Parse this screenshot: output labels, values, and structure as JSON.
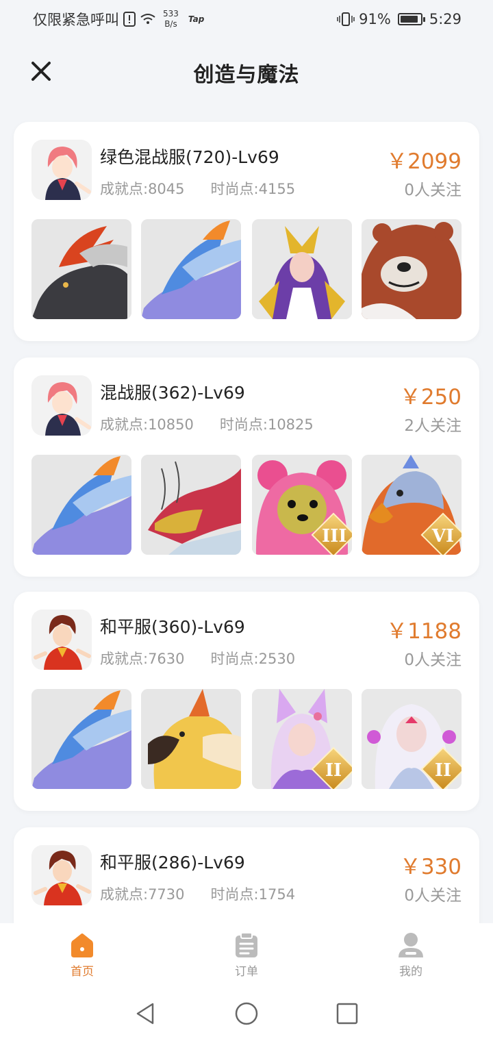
{
  "status_bar": {
    "carrier_text": "仅限紧急呼叫",
    "net_speed_value": "533",
    "net_speed_unit": "B/s",
    "tap_label": "Tap",
    "battery_percent": "91%",
    "battery_level": 0.91,
    "time": "5:29"
  },
  "header": {
    "title": "创造与魔法",
    "close_icon": "close-icon"
  },
  "listings": [
    {
      "title": "绿色混战服(720)-Lv69",
      "achievement": "成就点:8045",
      "fashion": "时尚点:4155",
      "price": "￥2099",
      "followers": "0人关注",
      "thumbs": [
        {
          "name": "black-dragon-mount",
          "rank": ""
        },
        {
          "name": "blue-dragon-mount",
          "rank": ""
        },
        {
          "name": "golden-sorceress-skin",
          "rank": ""
        },
        {
          "name": "brown-bear-mount",
          "rank": ""
        }
      ]
    },
    {
      "title": "混战服(362)-Lv69",
      "achievement": "成就点:10850",
      "fashion": "时尚点:10825",
      "price": "￥250",
      "followers": "2人关注",
      "thumbs": [
        {
          "name": "blue-dragon-mount",
          "rank": ""
        },
        {
          "name": "golden-dragon-mount",
          "rank": ""
        },
        {
          "name": "pink-bear-mount",
          "rank": "III"
        },
        {
          "name": "eagle-mount",
          "rank": "VI"
        }
      ]
    },
    {
      "title": "和平服(360)-Lv69",
      "achievement": "成就点:7630",
      "fashion": "时尚点:2530",
      "price": "￥1188",
      "followers": "0人关注",
      "thumbs": [
        {
          "name": "blue-dragon-mount",
          "rank": ""
        },
        {
          "name": "golden-eagle-mount",
          "rank": ""
        },
        {
          "name": "fox-spirit-skin",
          "rank": "II"
        },
        {
          "name": "white-spirit-skin",
          "rank": "II"
        }
      ]
    },
    {
      "title": "和平服(286)-Lv69",
      "achievement": "成就点:7730",
      "fashion": "时尚点:1754",
      "price": "￥330",
      "followers": "0人关注",
      "thumbs": []
    }
  ],
  "tabbar": {
    "tabs": [
      {
        "label": "首页",
        "icon": "home-icon",
        "active": true
      },
      {
        "label": "订单",
        "icon": "order-icon",
        "active": false
      },
      {
        "label": "我的",
        "icon": "profile-icon",
        "active": false
      }
    ]
  },
  "nav": {
    "back_icon": "back-triangle-icon",
    "home_icon": "home-circle-icon",
    "recent_icon": "recent-square-icon"
  },
  "colors": {
    "accent": "#e07b2e",
    "price": "#e07b2e",
    "muted_text": "#999999",
    "page_bg": "#f3f5f8"
  }
}
